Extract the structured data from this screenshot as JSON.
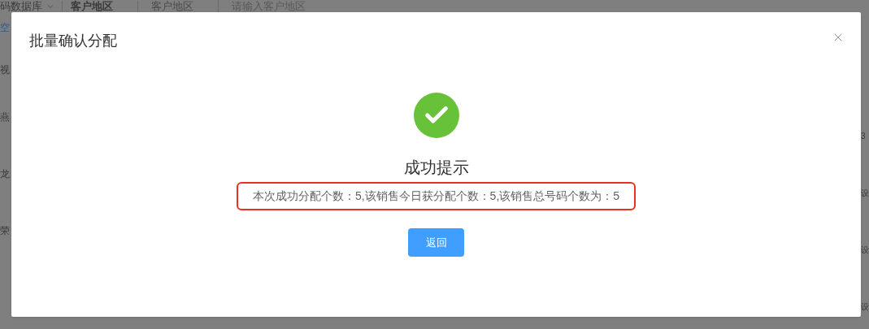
{
  "background": {
    "top_bar": [
      "码数据库",
      "客户地区",
      "客户地区"
    ],
    "region_field": {
      "placeholder": "请输入客户地区"
    },
    "left_column": [
      "空",
      "视",
      "燕",
      "龙",
      "荣"
    ],
    "right_column": [
      "3",
      "设",
      "设",
      "设"
    ]
  },
  "dialog": {
    "title": "批量确认分配",
    "result_title": "成功提示",
    "message": "本次成功分配个数：5,该销售今日获分配个数：5,该销售总号码个数为：5",
    "message_highlighted": true,
    "button": "返回"
  }
}
